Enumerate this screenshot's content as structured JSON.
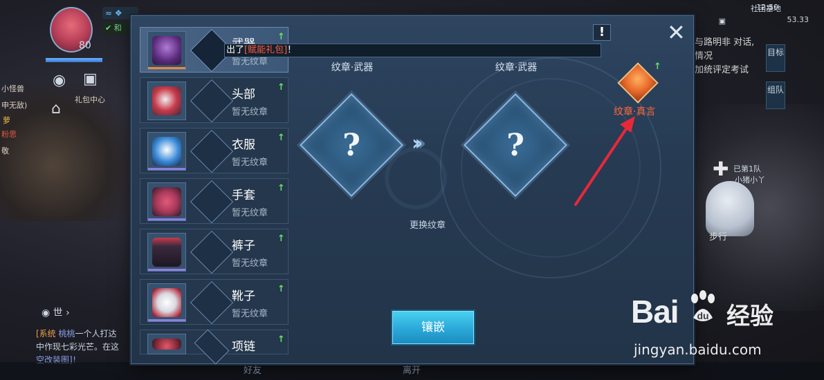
{
  "hud": {
    "level": "80",
    "badge1": "≈ ❖",
    "badge2": "✔ 和",
    "menu_label": "社团基地",
    "time": "12:50",
    "fps": "53.33",
    "gift_center": "礼包中心"
  },
  "left_side": {
    "lines": [
      "小怪兽",
      "申无敌)",
      "萝",
      "粉思",
      "敬"
    ]
  },
  "right_side": {
    "quest_line1": "与路明非 对话,",
    "quest_line2": "情况",
    "quest_line3": "加统评定考试",
    "tab1": "目标",
    "tab2": "组队",
    "walk": "步行",
    "team_text": "已第1队",
    "pet_name": "小猪小丫"
  },
  "chat": {
    "channel": "世",
    "tag": "[系统",
    "name": "桃桃",
    "line1_rest": "一个人打达",
    "line2": "中作现七彩光芒。在这",
    "line3": "空改装图]！"
  },
  "bottom": {
    "friends": "好友",
    "leave": "离开"
  },
  "equipment": [
    {
      "name": "武器",
      "sub": "暂无纹章",
      "up": "↑",
      "icon": "weapon-icon",
      "rarity": "orange",
      "color": "#5a2a7a"
    },
    {
      "name": "头部",
      "sub": "暂无纹章",
      "up": "↑",
      "icon": "helmet-icon",
      "rarity": "none",
      "color": "#c83a4a"
    },
    {
      "name": "衣服",
      "sub": "暂无纹章",
      "up": "↑",
      "icon": "clothes-icon",
      "rarity": "purple",
      "color": "#3a8ad8"
    },
    {
      "name": "手套",
      "sub": "暂无纹章",
      "up": "↑",
      "icon": "gloves-icon",
      "rarity": "purple",
      "color": "#a83a5a"
    },
    {
      "name": "裤子",
      "sub": "暂无纹章",
      "up": "↑",
      "icon": "pants-icon",
      "rarity": "purple",
      "color": "#3a2a3e"
    },
    {
      "name": "靴子",
      "sub": "暂无纹章",
      "up": "↑",
      "icon": "boots-icon",
      "rarity": "purple",
      "color": "#d8d8e0"
    },
    {
      "name": "项链",
      "sub": "暂无纹章",
      "up": "↑",
      "icon": "necklace-icon",
      "rarity": "purple",
      "color": "#8a2a3a"
    }
  ],
  "tooltip": {
    "prefix": "出了",
    "highlight": "[赋能礼包]",
    "suffix": "！"
  },
  "emblem": {
    "left_label": "纹章·武器",
    "right_label": "纹章·武器",
    "left_symbol": "?",
    "right_symbol": "?",
    "arrows": "›››",
    "change_label": "更换纹章"
  },
  "inlay_button": "镶嵌",
  "info_button": "!",
  "close_button": "✕",
  "gem": {
    "label": "纹章·真言",
    "up": "↑",
    "icon": "true-word-emblem-icon"
  },
  "watermark": {
    "logo_left": "Bai",
    "logo_right": "经验",
    "url": "jingyan.baidu.com"
  },
  "colors": {
    "accent": "#2aa8d8",
    "highlight": "#ff5a40",
    "upgrade": "#6ae06a",
    "annotation": "#e8283a"
  }
}
